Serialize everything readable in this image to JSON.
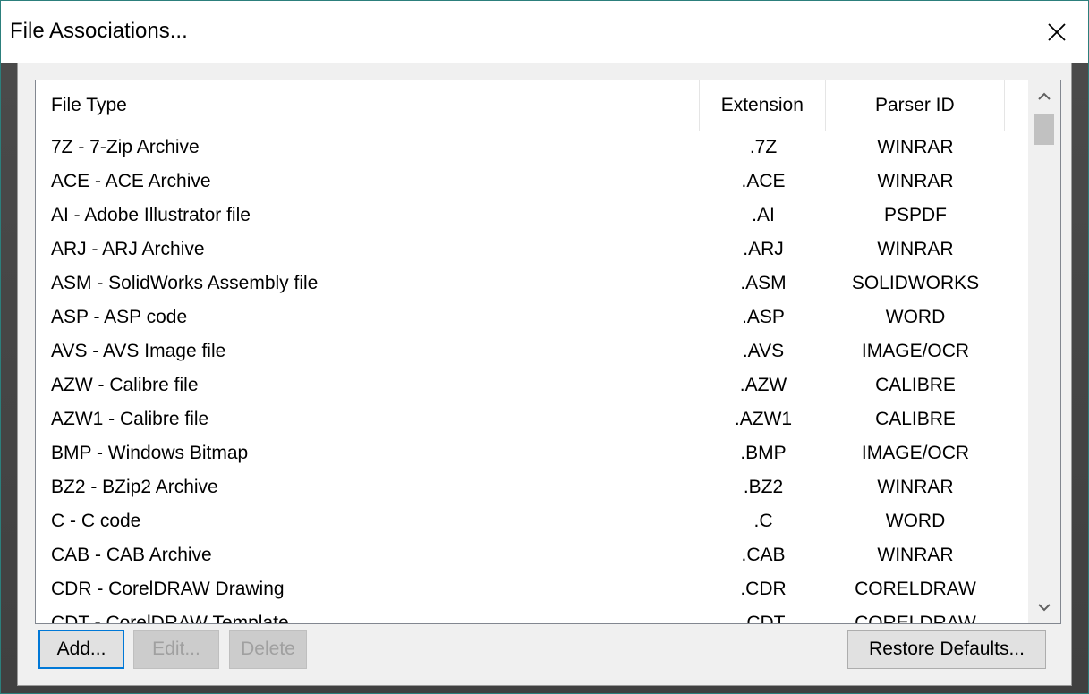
{
  "window": {
    "title": "File Associations..."
  },
  "list": {
    "headers": {
      "file_type": "File Type",
      "extension": "Extension",
      "parser_id": "Parser ID"
    },
    "rows": [
      {
        "file_type": "7Z - 7-Zip Archive",
        "extension": ".7Z",
        "parser_id": "WINRAR"
      },
      {
        "file_type": "ACE - ACE Archive",
        "extension": ".ACE",
        "parser_id": "WINRAR"
      },
      {
        "file_type": "AI - Adobe Illustrator file",
        "extension": ".AI",
        "parser_id": "PSPDF"
      },
      {
        "file_type": "ARJ - ARJ Archive",
        "extension": ".ARJ",
        "parser_id": "WINRAR"
      },
      {
        "file_type": "ASM - SolidWorks Assembly file",
        "extension": ".ASM",
        "parser_id": "SOLIDWORKS"
      },
      {
        "file_type": "ASP - ASP code",
        "extension": ".ASP",
        "parser_id": "WORD"
      },
      {
        "file_type": "AVS - AVS Image file",
        "extension": ".AVS",
        "parser_id": "IMAGE/OCR"
      },
      {
        "file_type": "AZW - Calibre file",
        "extension": ".AZW",
        "parser_id": "CALIBRE"
      },
      {
        "file_type": "AZW1 - Calibre file",
        "extension": ".AZW1",
        "parser_id": "CALIBRE"
      },
      {
        "file_type": "BMP - Windows Bitmap",
        "extension": ".BMP",
        "parser_id": "IMAGE/OCR"
      },
      {
        "file_type": "BZ2 - BZip2 Archive",
        "extension": ".BZ2",
        "parser_id": "WINRAR"
      },
      {
        "file_type": "C - C code",
        "extension": ".C",
        "parser_id": "WORD"
      },
      {
        "file_type": "CAB - CAB Archive",
        "extension": ".CAB",
        "parser_id": "WINRAR"
      },
      {
        "file_type": "CDR - CorelDRAW Drawing",
        "extension": ".CDR",
        "parser_id": "CORELDRAW"
      },
      {
        "file_type": "CDT - CorelDRAW Template",
        "extension": ".CDT",
        "parser_id": "CORELDRAW"
      }
    ]
  },
  "buttons": {
    "add": "Add...",
    "edit": "Edit...",
    "delete": "Delete",
    "restore": "Restore Defaults..."
  },
  "icons": {
    "close": "close-icon",
    "scroll_up": "chevron-up-icon",
    "scroll_down": "chevron-down-icon"
  },
  "colors": {
    "border_accent": "#2c7f7c",
    "focus": "#0078d7"
  }
}
